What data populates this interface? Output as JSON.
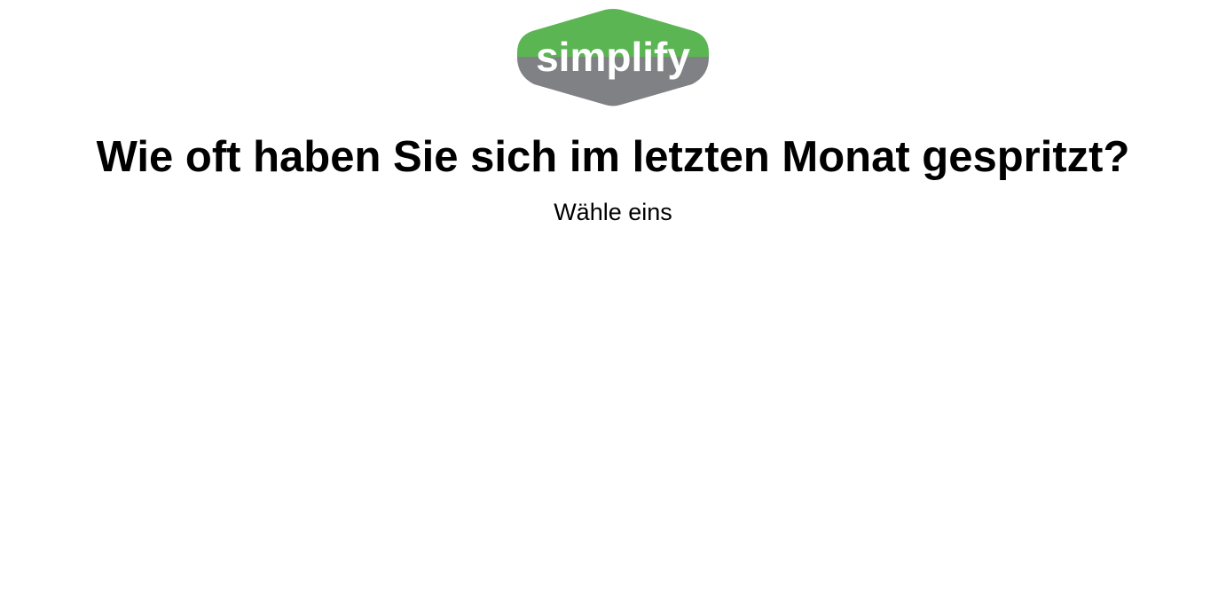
{
  "logo": {
    "text": "simplify",
    "colors": {
      "top": "#5bb553",
      "bottom": "#808184",
      "text": "#ffffff"
    }
  },
  "question": {
    "title": "Wie oft haben Sie sich im letzten Monat gespritzt?",
    "hint": "Wähle eins"
  }
}
